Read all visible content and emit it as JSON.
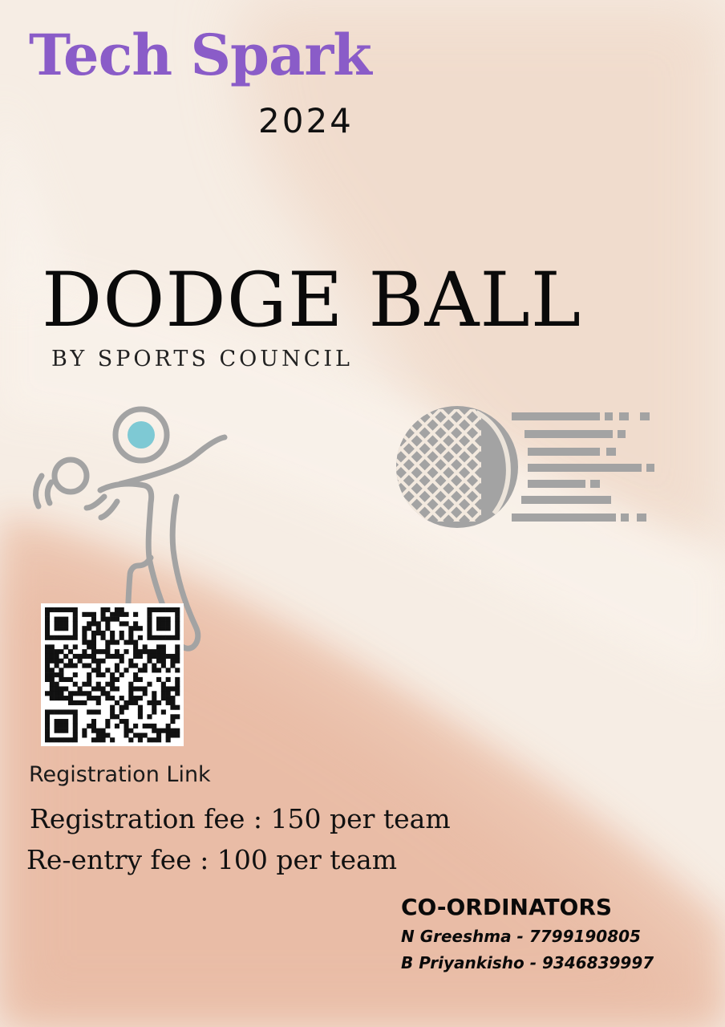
{
  "event": {
    "name": "Tech Spark",
    "year": "2024"
  },
  "game": {
    "title": "DODGE BALL",
    "subtitle": "BY SPORTS COUNCIL"
  },
  "registration": {
    "link_label": "Registration Link",
    "fee_line": "Registration fee : 150 per team",
    "reentry_line": "Re-entry fee : 100 per team"
  },
  "coordinators": {
    "heading": "CO-ORDINATORS",
    "people": [
      "N Greeshma - 7799190805",
      "B Priyankisho - 9346839997"
    ]
  },
  "icons": {
    "player": "dodgeball-player-icon",
    "ball": "moving-ball-icon",
    "qr": "qr-code"
  },
  "colors": {
    "title_purple": "#8a5cc8",
    "accent_teal": "#7ec9d4",
    "illustration_gray": "#a3a3a3",
    "background_cream": "#f6ede4",
    "background_peach": "#ecc2ac"
  }
}
